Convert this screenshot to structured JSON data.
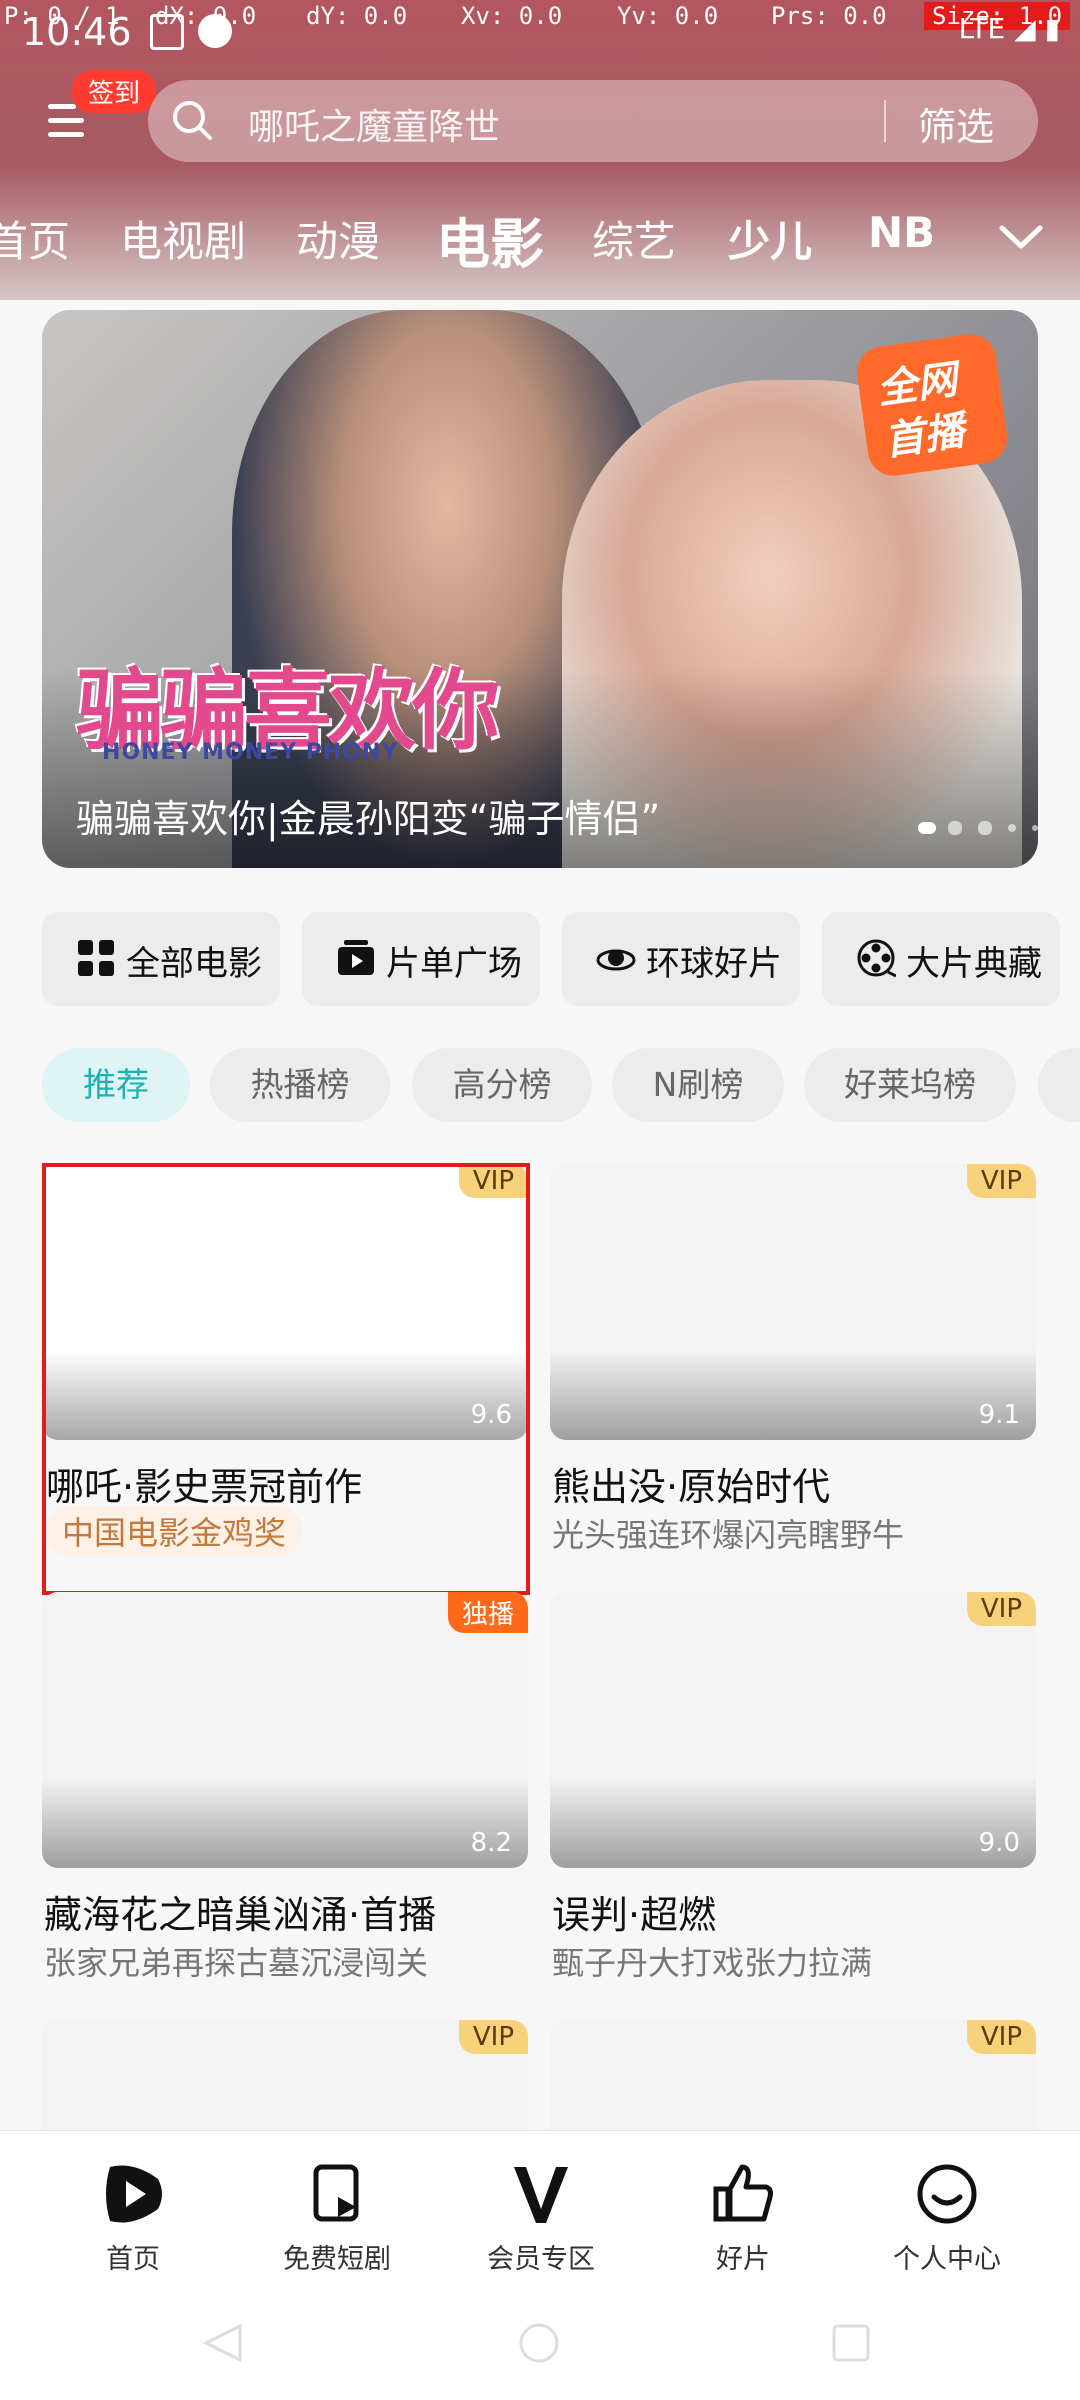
{
  "status_bar": {
    "time": "10:46",
    "debug": {
      "p": "P: 0 / 1",
      "dx": "dX: 0.0",
      "dy": "dY: 0.0",
      "xv": "Xv: 0.0",
      "yv": "Yv: 0.0",
      "prs": "Prs: 0.0",
      "size": "Size: 1.0"
    },
    "network": "LTE"
  },
  "header": {
    "checkin_badge": "签到",
    "search_placeholder": "哪吒之魔童降世",
    "filter_label": "筛选",
    "channels": [
      "首页",
      "电视剧",
      "动漫",
      "电影",
      "综艺",
      "少儿",
      "NBA"
    ],
    "active_channel": "电影"
  },
  "banner": {
    "logo_text": "骗骗喜欢你",
    "logo_en": "HONEY MONEY PHONY",
    "badge_line1": "全网",
    "badge_line2": "首播",
    "caption": "骗骗喜欢你|金晨孙阳变“骗子情侣”",
    "dots_count": 5,
    "active_dot": 0
  },
  "categories": [
    {
      "label": "全部电影",
      "icon": "grid-icon"
    },
    {
      "label": "片单广场",
      "icon": "playlist-icon"
    },
    {
      "label": "环球好片",
      "icon": "universal-icon"
    },
    {
      "label": "大片典藏",
      "icon": "film-reel-icon"
    }
  ],
  "chips": [
    "推荐",
    "热播榜",
    "高分榜",
    "N刷榜",
    "好莱坞榜"
  ],
  "active_chip": "推荐",
  "cards": [
    {
      "title": "哪吒·影史票冠前作",
      "subtitle": "中国电影金鸡奖",
      "score": "9.6",
      "tag": "VIP"
    },
    {
      "title": "熊出没·原始时代",
      "subtitle": "光头强连环爆闪亮瞎野牛",
      "score": "9.1",
      "tag": "VIP"
    },
    {
      "title": "藏海花之暗巢汹涌·首播",
      "subtitle": "张家兄弟再探古墓沉浸闯关",
      "score": "8.2",
      "tag": "独播"
    },
    {
      "title": "误判·超燃",
      "subtitle": "甄子丹大打戏张力拉满",
      "score": "9.0",
      "tag": "VIP"
    },
    {
      "title": "",
      "subtitle": "",
      "score": "",
      "tag": "VIP"
    },
    {
      "title": "",
      "subtitle": "",
      "score": "",
      "tag": "VIP"
    }
  ],
  "bottom_nav": [
    {
      "label": "首页",
      "icon": "home-play-icon"
    },
    {
      "label": "免费短剧",
      "icon": "short-drama-icon"
    },
    {
      "label": "会员专区",
      "icon": "vip-v-icon"
    },
    {
      "label": "好片",
      "icon": "thumbs-up-icon"
    },
    {
      "label": "个人中心",
      "icon": "profile-smile-icon"
    }
  ],
  "colors": {
    "header_bg": "#b3565f",
    "accent_teal": "#1bb1b5",
    "vip_gold": "#f8d27a",
    "exclusive_orange": "#ff6a1a",
    "highlight_red": "#e31b1b"
  }
}
